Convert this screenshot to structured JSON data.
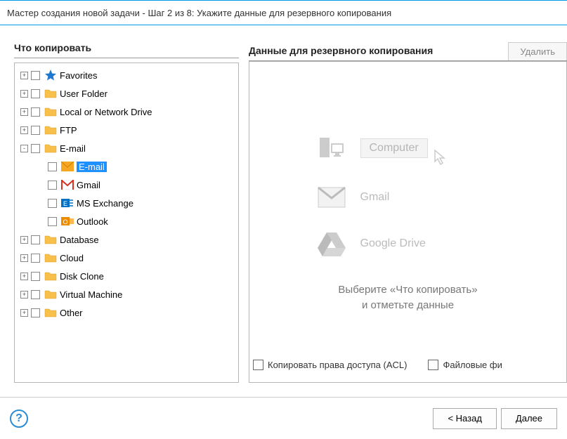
{
  "window": {
    "title": "Мастер создания новой задачи - Шаг 2 из 8: Укажите данные для резервного копирования"
  },
  "left": {
    "header": "Что копировать",
    "tree": [
      {
        "id": "favorites",
        "label": "Favorites",
        "icon": "star",
        "expander": "+",
        "indent": 0
      },
      {
        "id": "user-folder",
        "label": "User Folder",
        "icon": "folder",
        "expander": "+",
        "indent": 0
      },
      {
        "id": "local-drive",
        "label": "Local or Network Drive",
        "icon": "folder",
        "expander": "+",
        "indent": 0
      },
      {
        "id": "ftp",
        "label": "FTP",
        "icon": "folder",
        "expander": "+",
        "indent": 0
      },
      {
        "id": "email-root",
        "label": "E-mail",
        "icon": "folder",
        "expander": "-",
        "indent": 0
      },
      {
        "id": "email",
        "label": "E-mail",
        "icon": "envelope",
        "indent": 1,
        "selected": true
      },
      {
        "id": "gmail",
        "label": "Gmail",
        "icon": "gmail",
        "indent": 1
      },
      {
        "id": "ms-exchange",
        "label": "MS Exchange",
        "icon": "exchange",
        "indent": 1
      },
      {
        "id": "outlook",
        "label": "Outlook",
        "icon": "outlook",
        "indent": 1
      },
      {
        "id": "database",
        "label": "Database",
        "icon": "folder",
        "expander": "+",
        "indent": 0
      },
      {
        "id": "cloud",
        "label": "Cloud",
        "icon": "folder",
        "expander": "+",
        "indent": 0
      },
      {
        "id": "disk-clone",
        "label": "Disk Clone",
        "icon": "folder",
        "expander": "+",
        "indent": 0
      },
      {
        "id": "virtual-machine",
        "label": "Virtual Machine",
        "icon": "folder",
        "expander": "+",
        "indent": 0
      },
      {
        "id": "other",
        "label": "Other",
        "icon": "folder",
        "expander": "+",
        "indent": 0
      }
    ]
  },
  "right": {
    "header": "Данные для резервного копирования",
    "delete_btn": "Удалить",
    "preview": {
      "computer": "Computer",
      "gmail": "Gmail",
      "gdrive": "Google Drive"
    },
    "instruction_line1": "Выберите «Что копировать»",
    "instruction_line2": "и отметьте данные"
  },
  "options": {
    "acl": "Копировать права доступа (ACL)",
    "filters": "Файловые фи"
  },
  "footer": {
    "back": "< Назад",
    "next": "Далее"
  }
}
